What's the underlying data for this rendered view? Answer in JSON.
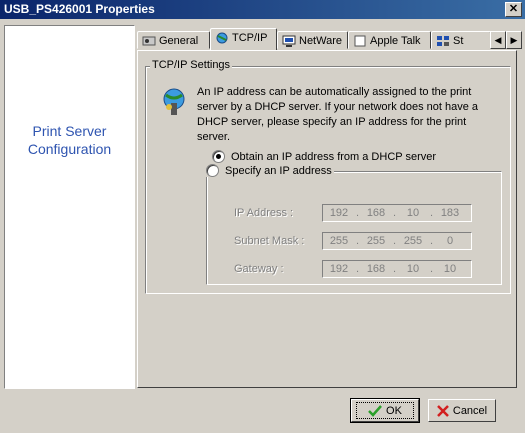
{
  "window": {
    "title": "USB_PS426001 Properties",
    "close_label": "✕"
  },
  "sidebar": {
    "caption_line1": "Print Server",
    "caption_line2": "Configuration"
  },
  "tabs": [
    {
      "label": "General",
      "icon": "general-icon"
    },
    {
      "label": "TCP/IP",
      "icon": "tcpip-icon",
      "active": true
    },
    {
      "label": "NetWare",
      "icon": "netware-icon"
    },
    {
      "label": "Apple Talk",
      "icon": "appletalk-icon"
    },
    {
      "label": "St",
      "icon": "status-icon"
    }
  ],
  "tcpip": {
    "group_title": "TCP/IP Settings",
    "description": "An IP address can be automatically assigned to the print server by a DHCP server. If your network does not have a DHCP server, please specify an IP address for the print server.",
    "option_dhcp": "Obtain an IP address from a DHCP server",
    "option_dhcp_selected": true,
    "option_static": "Specify an IP address",
    "fields": {
      "ip_label": "IP Address :",
      "ip": [
        "192",
        "168",
        "10",
        "183"
      ],
      "mask_label": "Subnet Mask :",
      "mask": [
        "255",
        "255",
        "255",
        "0"
      ],
      "gw_label": "Gateway :",
      "gw": [
        "192",
        "168",
        "10",
        "10"
      ]
    }
  },
  "buttons": {
    "ok": "OK",
    "cancel": "Cancel"
  },
  "colors": {
    "titlebar_start": "#0a246a",
    "titlebar_end": "#3a6ea5",
    "caption": "#2e54b0",
    "ok_check": "#2aa02a",
    "cancel_x": "#d21f1f"
  }
}
